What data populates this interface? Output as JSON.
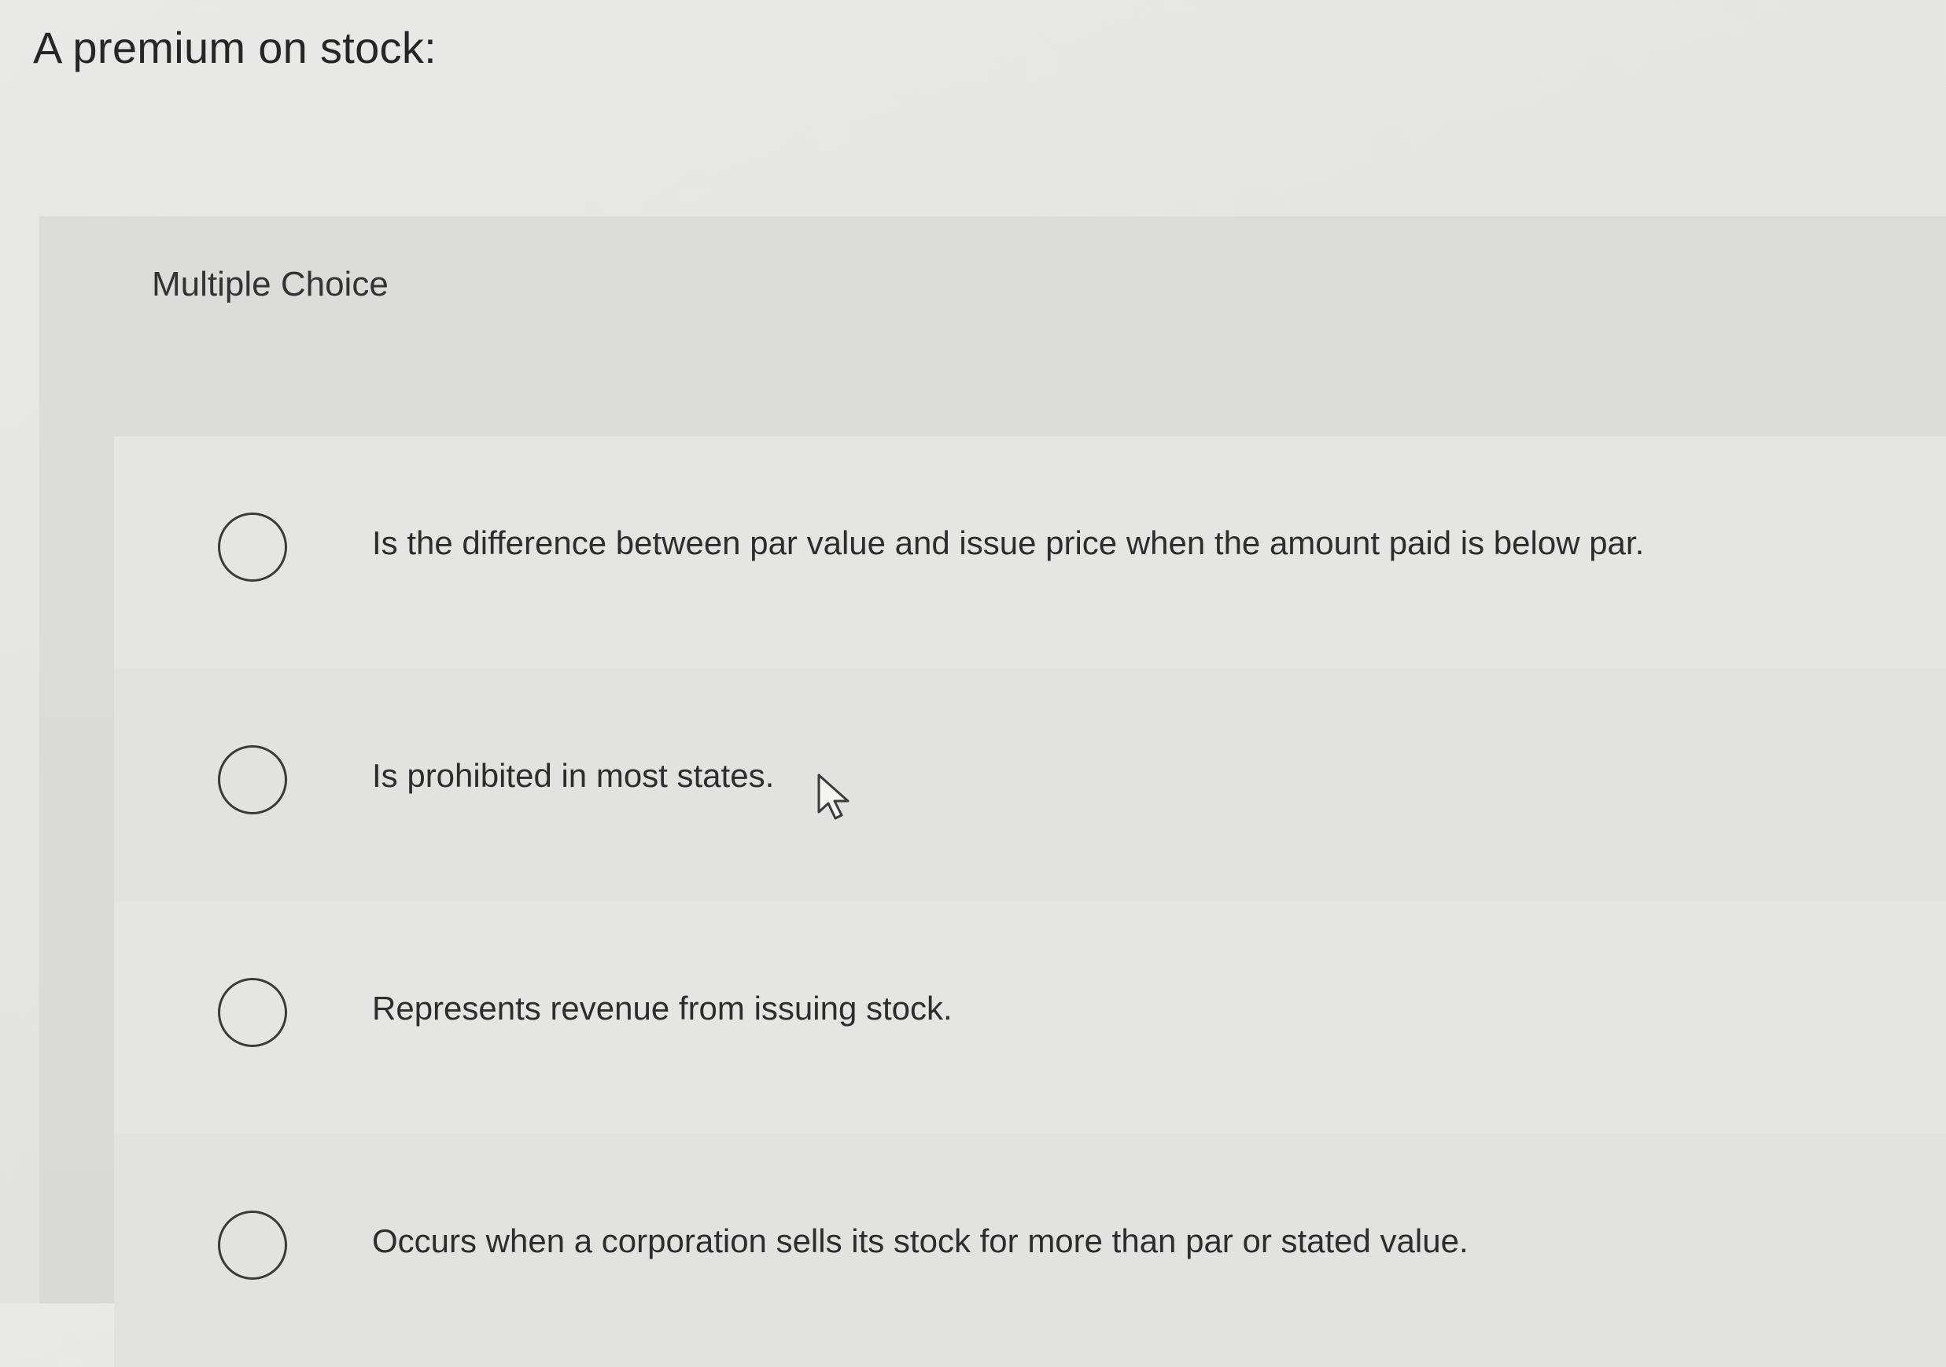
{
  "question": {
    "prompt": "A premium on stock:"
  },
  "panel": {
    "type_label": "Multiple Choice"
  },
  "options": [
    {
      "text": "Is the difference between par value and issue price when the amount paid is below par."
    },
    {
      "text": "Is prohibited in most states."
    },
    {
      "text": "Represents revenue from issuing stock."
    },
    {
      "text": "Occurs when a corporation sells its stock for more than par or stated value."
    }
  ],
  "cursor": {
    "icon": "arrow-cursor-icon"
  }
}
